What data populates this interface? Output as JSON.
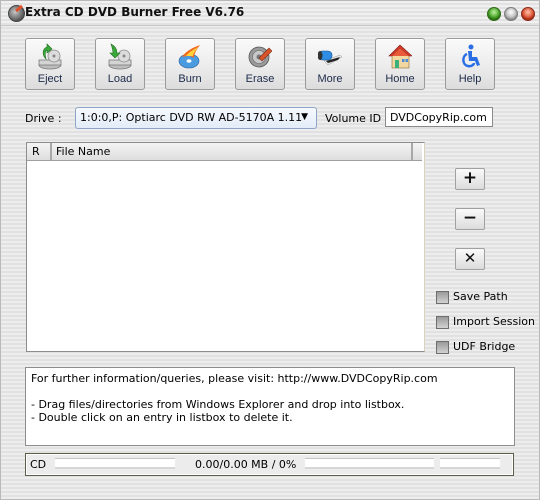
{
  "window": {
    "title": "Extra CD DVD Burner Free V6.76",
    "controls": [
      "minimize",
      "maximize",
      "close"
    ]
  },
  "toolbar": {
    "buttons": [
      {
        "label": "Eject",
        "icon": "eject-drive-icon"
      },
      {
        "label": "Load",
        "icon": "load-drive-icon"
      },
      {
        "label": "Burn",
        "icon": "burn-disc-icon"
      },
      {
        "label": "Erase",
        "icon": "erase-disc-icon"
      },
      {
        "label": "More",
        "icon": "more-film-icon"
      },
      {
        "label": "Home",
        "icon": "home-icon"
      },
      {
        "label": "Help",
        "icon": "help-accessibility-icon"
      }
    ]
  },
  "drive": {
    "label": "Drive :",
    "selected": "1:0:0,P: Optiarc  DVD RW AD-5170A  1.11",
    "arrow": "▼"
  },
  "volume": {
    "label": "Volume ID :",
    "value": "DVDCopyRip.com"
  },
  "filelist": {
    "columns": [
      "R",
      "File Name"
    ],
    "rows": []
  },
  "side_buttons": {
    "add": "+",
    "remove": "−",
    "clear": "✕"
  },
  "options": [
    {
      "label": "Save Path",
      "checked": false
    },
    {
      "label": "Import Session",
      "checked": false
    },
    {
      "label": "UDF Bridge",
      "checked": false
    }
  ],
  "info": {
    "lines": [
      "For further information/queries, please visit: http://www.DVDCopyRip.com",
      "- Drag files/directories from Windows Explorer and drop into listbox.",
      "- Double click on an entry in listbox to delete it."
    ]
  },
  "status": {
    "media": "CD",
    "size_text": "0.00/0.00 MB / 0%",
    "progress_percent": 0
  },
  "colors": {
    "label_text": "#1c2a4a",
    "drive_border": "#8fa5c7"
  }
}
